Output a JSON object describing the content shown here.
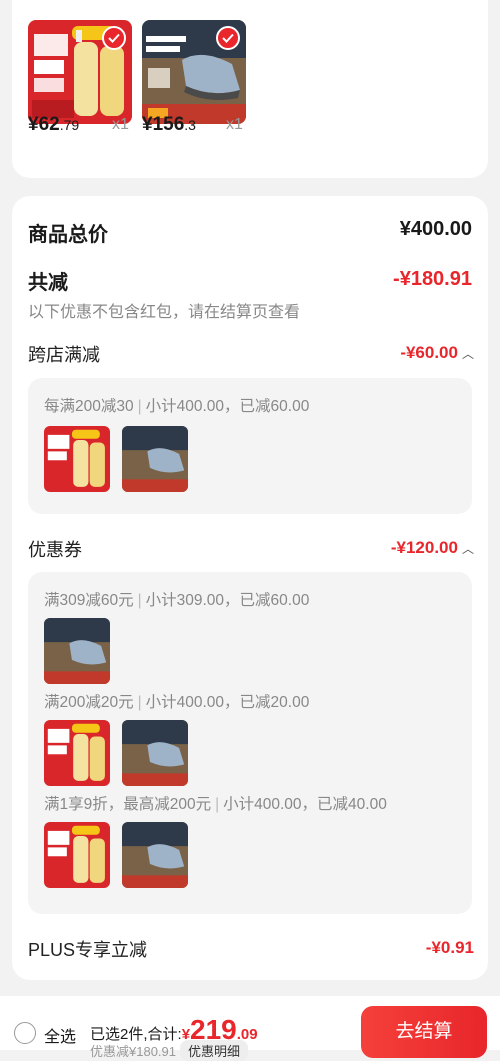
{
  "cart_items": [
    {
      "price_int": "¥62",
      "price_dec": ".79",
      "qty": "x1"
    },
    {
      "price_int": "¥156",
      "price_dec": ".3",
      "qty": "x1"
    }
  ],
  "summary": {
    "total_label": "商品总价",
    "total_value": "¥400.00",
    "reduce_label": "共减",
    "reduce_value": "-¥180.91",
    "note": "以下优惠不包含红包，请在结算页查看"
  },
  "cross_store": {
    "label": "跨店满减",
    "value": "-¥60.00",
    "rule_a": "每满200减30",
    "rule_b": "小计400.00，已减60.00"
  },
  "coupons": {
    "label": "优惠券",
    "value": "-¥120.00",
    "items": [
      {
        "rule_a": "满309减60元",
        "rule_b": "小计309.00，已减60.00"
      },
      {
        "rule_a": "满200减20元",
        "rule_b": "小计400.00，已减20.00"
      },
      {
        "rule_a": "满1享9折，最高减200元",
        "rule_b": "小计400.00，已减40.00"
      }
    ]
  },
  "plus": {
    "label": "PLUS专享立减",
    "value": "-¥0.91"
  },
  "bottom": {
    "select_all": "全选",
    "selected_text": "已选2件,合计:",
    "total_sym": "¥",
    "total_int": "219",
    "total_dec": ".09",
    "discount_text": "优惠减¥180.91",
    "detail_label": "优惠明细",
    "checkout_label": "去结算"
  },
  "colors": {
    "accent": "#e8262b",
    "background": "#f2f2f2"
  },
  "icons": [
    "checkmark-icon",
    "chevron-up-icon",
    "radio-circle-icon"
  ]
}
